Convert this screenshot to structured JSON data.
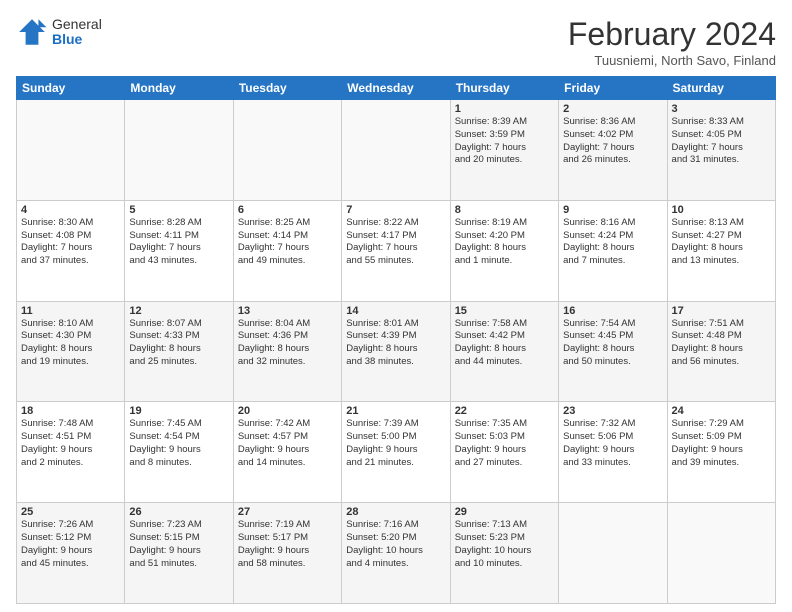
{
  "logo": {
    "general": "General",
    "blue": "Blue"
  },
  "title": "February 2024",
  "location": "Tuusniemi, North Savo, Finland",
  "days_of_week": [
    "Sunday",
    "Monday",
    "Tuesday",
    "Wednesday",
    "Thursday",
    "Friday",
    "Saturday"
  ],
  "weeks": [
    [
      {
        "day": "",
        "info": ""
      },
      {
        "day": "",
        "info": ""
      },
      {
        "day": "",
        "info": ""
      },
      {
        "day": "",
        "info": ""
      },
      {
        "day": "1",
        "info": "Sunrise: 8:39 AM\nSunset: 3:59 PM\nDaylight: 7 hours\nand 20 minutes."
      },
      {
        "day": "2",
        "info": "Sunrise: 8:36 AM\nSunset: 4:02 PM\nDaylight: 7 hours\nand 26 minutes."
      },
      {
        "day": "3",
        "info": "Sunrise: 8:33 AM\nSunset: 4:05 PM\nDaylight: 7 hours\nand 31 minutes."
      }
    ],
    [
      {
        "day": "4",
        "info": "Sunrise: 8:30 AM\nSunset: 4:08 PM\nDaylight: 7 hours\nand 37 minutes."
      },
      {
        "day": "5",
        "info": "Sunrise: 8:28 AM\nSunset: 4:11 PM\nDaylight: 7 hours\nand 43 minutes."
      },
      {
        "day": "6",
        "info": "Sunrise: 8:25 AM\nSunset: 4:14 PM\nDaylight: 7 hours\nand 49 minutes."
      },
      {
        "day": "7",
        "info": "Sunrise: 8:22 AM\nSunset: 4:17 PM\nDaylight: 7 hours\nand 55 minutes."
      },
      {
        "day": "8",
        "info": "Sunrise: 8:19 AM\nSunset: 4:20 PM\nDaylight: 8 hours\nand 1 minute."
      },
      {
        "day": "9",
        "info": "Sunrise: 8:16 AM\nSunset: 4:24 PM\nDaylight: 8 hours\nand 7 minutes."
      },
      {
        "day": "10",
        "info": "Sunrise: 8:13 AM\nSunset: 4:27 PM\nDaylight: 8 hours\nand 13 minutes."
      }
    ],
    [
      {
        "day": "11",
        "info": "Sunrise: 8:10 AM\nSunset: 4:30 PM\nDaylight: 8 hours\nand 19 minutes."
      },
      {
        "day": "12",
        "info": "Sunrise: 8:07 AM\nSunset: 4:33 PM\nDaylight: 8 hours\nand 25 minutes."
      },
      {
        "day": "13",
        "info": "Sunrise: 8:04 AM\nSunset: 4:36 PM\nDaylight: 8 hours\nand 32 minutes."
      },
      {
        "day": "14",
        "info": "Sunrise: 8:01 AM\nSunset: 4:39 PM\nDaylight: 8 hours\nand 38 minutes."
      },
      {
        "day": "15",
        "info": "Sunrise: 7:58 AM\nSunset: 4:42 PM\nDaylight: 8 hours\nand 44 minutes."
      },
      {
        "day": "16",
        "info": "Sunrise: 7:54 AM\nSunset: 4:45 PM\nDaylight: 8 hours\nand 50 minutes."
      },
      {
        "day": "17",
        "info": "Sunrise: 7:51 AM\nSunset: 4:48 PM\nDaylight: 8 hours\nand 56 minutes."
      }
    ],
    [
      {
        "day": "18",
        "info": "Sunrise: 7:48 AM\nSunset: 4:51 PM\nDaylight: 9 hours\nand 2 minutes."
      },
      {
        "day": "19",
        "info": "Sunrise: 7:45 AM\nSunset: 4:54 PM\nDaylight: 9 hours\nand 8 minutes."
      },
      {
        "day": "20",
        "info": "Sunrise: 7:42 AM\nSunset: 4:57 PM\nDaylight: 9 hours\nand 14 minutes."
      },
      {
        "day": "21",
        "info": "Sunrise: 7:39 AM\nSunset: 5:00 PM\nDaylight: 9 hours\nand 21 minutes."
      },
      {
        "day": "22",
        "info": "Sunrise: 7:35 AM\nSunset: 5:03 PM\nDaylight: 9 hours\nand 27 minutes."
      },
      {
        "day": "23",
        "info": "Sunrise: 7:32 AM\nSunset: 5:06 PM\nDaylight: 9 hours\nand 33 minutes."
      },
      {
        "day": "24",
        "info": "Sunrise: 7:29 AM\nSunset: 5:09 PM\nDaylight: 9 hours\nand 39 minutes."
      }
    ],
    [
      {
        "day": "25",
        "info": "Sunrise: 7:26 AM\nSunset: 5:12 PM\nDaylight: 9 hours\nand 45 minutes."
      },
      {
        "day": "26",
        "info": "Sunrise: 7:23 AM\nSunset: 5:15 PM\nDaylight: 9 hours\nand 51 minutes."
      },
      {
        "day": "27",
        "info": "Sunrise: 7:19 AM\nSunset: 5:17 PM\nDaylight: 9 hours\nand 58 minutes."
      },
      {
        "day": "28",
        "info": "Sunrise: 7:16 AM\nSunset: 5:20 PM\nDaylight: 10 hours\nand 4 minutes."
      },
      {
        "day": "29",
        "info": "Sunrise: 7:13 AM\nSunset: 5:23 PM\nDaylight: 10 hours\nand 10 minutes."
      },
      {
        "day": "",
        "info": ""
      },
      {
        "day": "",
        "info": ""
      }
    ]
  ]
}
